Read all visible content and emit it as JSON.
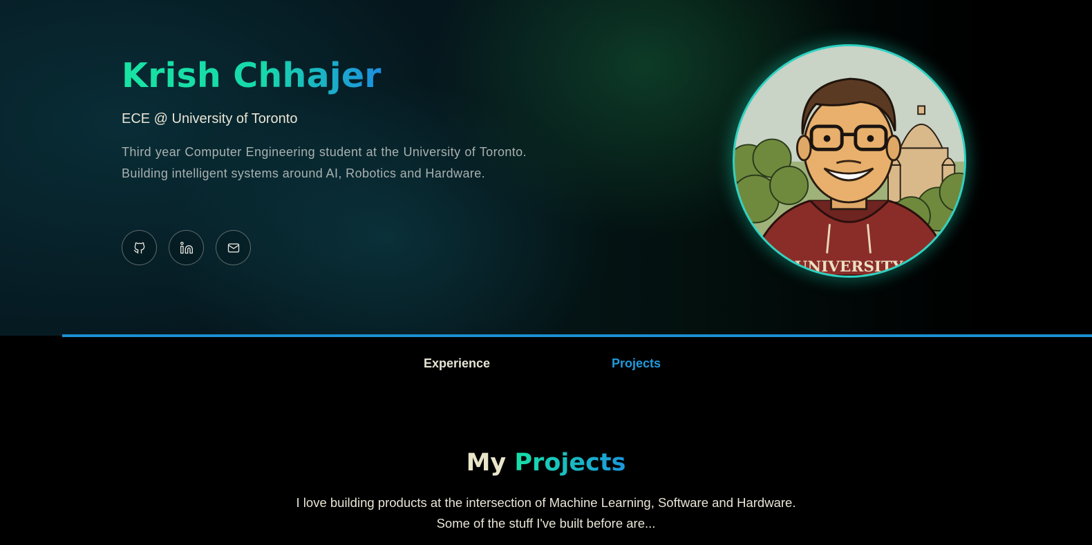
{
  "hero": {
    "name": "Krish Chhajer",
    "subtitle": "ECE @ University of Toronto",
    "bio": "Third year Computer Engineering student at the University of Toronto. Building intelligent systems around AI, Robotics and Hardware.",
    "socials": [
      {
        "icon": "github-icon"
      },
      {
        "icon": "linkedin-icon"
      },
      {
        "icon": "mail-icon"
      }
    ],
    "avatar_text": "UNIVERSITY"
  },
  "tabs": [
    {
      "label": "Experience",
      "active": false
    },
    {
      "label": "Projects",
      "active": true
    }
  ],
  "projects_section": {
    "title_part1": "My",
    "title_part2": "Projects",
    "description_line1": "I love building products at the intersection of Machine Learning, Software and Hardware.",
    "description_line2": "Some of the stuff I've built before are..."
  },
  "colors": {
    "accent_green": "#18e3a3",
    "accent_blue": "#1a8fd1",
    "text_light": "#e9e5d6",
    "text_muted": "#a9b1b0",
    "background": "#000000"
  }
}
